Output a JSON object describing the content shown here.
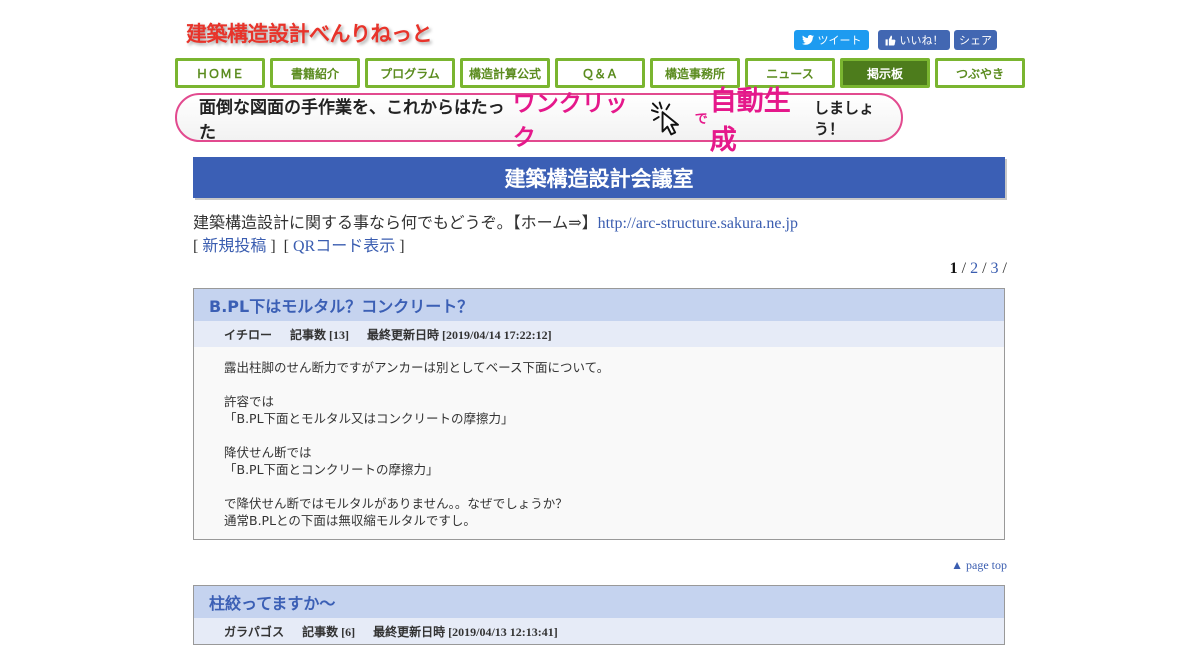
{
  "site": {
    "logo": "建築構造設計べんりねっと"
  },
  "social": {
    "tweet": "ツイート",
    "like": "いいね！",
    "share": "シェア"
  },
  "nav": [
    {
      "label": "ＨＯＭＥ"
    },
    {
      "label": "書籍紹介"
    },
    {
      "label": "プログラム"
    },
    {
      "label": "構造計算公式"
    },
    {
      "label": "Ｑ＆Ａ"
    },
    {
      "label": "構造事務所"
    },
    {
      "label": "ニュース"
    },
    {
      "label": "掲示板",
      "active": true
    },
    {
      "label": "つぶやき"
    }
  ],
  "banner": {
    "part1": "面倒な図面の手作業を、これからはたった",
    "part2": "ワンクリック",
    "part3": "で",
    "part4": "自動生成",
    "part5": "しましょう！"
  },
  "board": {
    "title": "建築構造設計会議室",
    "intro_text": "建築構造設計に関する事なら何でもどうぞ。【ホーム⇒】",
    "home_url": "http://arc-structure.sakura.ne.jp",
    "new_post": "新規投稿",
    "qr_code": "QRコード表示"
  },
  "pager": {
    "current": "1",
    "pages": [
      "2",
      "3"
    ]
  },
  "threads": [
    {
      "title": "B.PL下はモルタル？コンクリート？",
      "author": "イチロー",
      "count_label": "記事数 [13]",
      "updated_label": "最終更新日時 [2019/04/14 17:22:12]",
      "body": [
        "露出柱脚のせん断力ですがアンカーは別としてベース下面について。",
        "",
        "許容では",
        "「B.PL下面とモルタル又はコンクリートの摩擦力」",
        "",
        "降伏せん断では",
        "「B.PL下面とコンクリートの摩擦力」",
        "",
        "で降伏せん断ではモルタルがありません。。なぜでしょうか？",
        "通常B.PLとの下面は無収縮モルタルですし。"
      ]
    },
    {
      "title": "柱絞ってますか～",
      "author": "ガラパゴス",
      "count_label": "記事数 [6]",
      "updated_label": "最終更新日時 [2019/04/13 12:13:41]"
    }
  ],
  "page_top": "▲ page top"
}
